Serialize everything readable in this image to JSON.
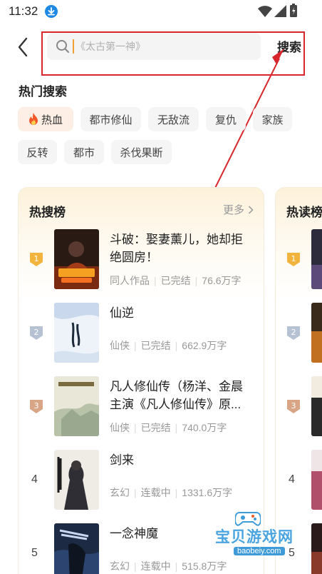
{
  "status_bar": {
    "time": "11:32"
  },
  "search": {
    "placeholder": "《太古第一神》",
    "button_label": "搜索"
  },
  "hot_search": {
    "title": "热门搜索",
    "tags": [
      "热血",
      "都市修仙",
      "无敌流",
      "复仇",
      "家族",
      "反转",
      "都市",
      "杀伐果断"
    ]
  },
  "hot_list": {
    "title": "热搜榜",
    "more_label": "更多",
    "books": [
      {
        "rank": "1",
        "title": "斗破：娶妻薰儿，她却拒绝圆房！",
        "genre": "同人作品",
        "status": "已完结",
        "words": "76.6万字"
      },
      {
        "rank": "2",
        "title": "仙逆",
        "genre": "仙侠",
        "status": "已完结",
        "words": "662.9万字"
      },
      {
        "rank": "3",
        "title": "凡人修仙传（杨洋、金晨主演《凡人修仙传》原...",
        "genre": "仙侠",
        "status": "已完结",
        "words": "740.0万字"
      },
      {
        "rank": "4",
        "title": "剑来",
        "genre": "玄幻",
        "status": "连载中",
        "words": "1331.6万字"
      },
      {
        "rank": "5",
        "title": "一念神魔",
        "genre": "玄幻",
        "status": "连载中",
        "words": "515.8万字"
      }
    ]
  },
  "hot_read": {
    "title": "热读榜",
    "ranks": [
      "1",
      "2",
      "3",
      "4",
      "5"
    ]
  },
  "watermark": {
    "text": "宝贝游戏网",
    "url": "baobeiy.com"
  },
  "colors": {
    "accent": "#f0a030",
    "annotation": "#d9262c",
    "rank1": "#f2b43c",
    "rank2": "#b6c2d3",
    "rank3": "#d8a586"
  }
}
